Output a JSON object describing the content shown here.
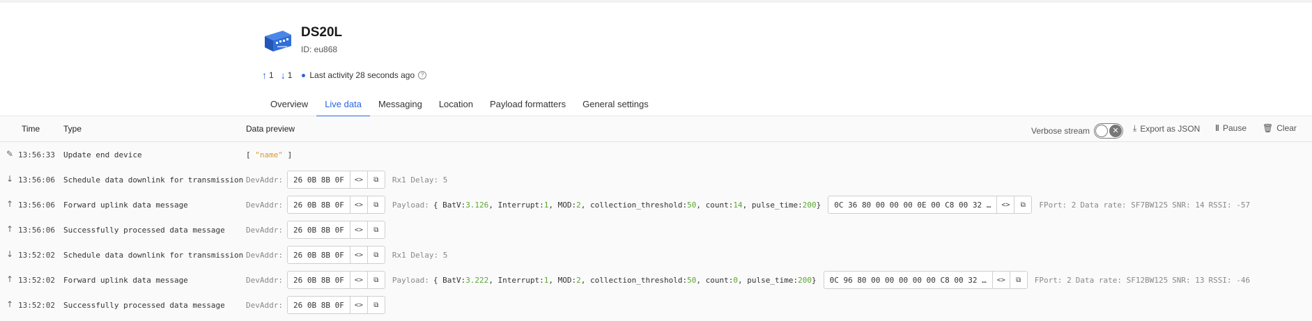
{
  "device": {
    "name": "DS20L",
    "id": "ID: eu868",
    "uplinks": "1",
    "downlinks": "1",
    "last_activity": "Last activity 28 seconds ago"
  },
  "tabs": [
    "Overview",
    "Live data",
    "Messaging",
    "Location",
    "Payload formatters",
    "General settings"
  ],
  "active_tab": "Live data",
  "table": {
    "headers": {
      "time": "Time",
      "type": "Type",
      "preview": "Data preview"
    },
    "controls": {
      "verbose": "Verbose stream",
      "export": "Export as JSON",
      "pause": "Pause",
      "clear": "Clear"
    }
  },
  "rows": [
    {
      "icon": "pencil-icon",
      "time": "13:56:33",
      "type": "Update end device",
      "preview": {
        "open": "[ ",
        "name": "\"name\"",
        "close": " ]"
      }
    },
    {
      "icon": "arrow-down-icon",
      "time": "13:56:06",
      "type": "Schedule data downlink for transmission",
      "devaddr_label": "DevAddr:",
      "devaddr": "26 0B 8B 0F",
      "extra": "Rx1 Delay: 5"
    },
    {
      "icon": "arrow-up-icon",
      "time": "13:56:06",
      "type": "Forward uplink data message",
      "devaddr_label": "DevAddr:",
      "devaddr": "26 0B 8B 0F",
      "payload": {
        "label": "Payload:",
        "BatV": "3.126",
        "Interrupt": "1",
        "MOD": "2",
        "collection_threshold": "50",
        "count": "14",
        "pulse_time": "200"
      },
      "raw": "0C 36 80 00 00 00 0E 00 C8 00 32 …",
      "fport": "FPort: 2",
      "rate": "Data rate: SF7BW125",
      "snr": "SNR: 14",
      "rssi": "RSSI: -57"
    },
    {
      "icon": "arrow-up-icon",
      "time": "13:56:06",
      "type": "Successfully processed data message",
      "devaddr_label": "DevAddr:",
      "devaddr": "26 0B 8B 0F"
    },
    {
      "icon": "arrow-down-icon",
      "time": "13:52:02",
      "type": "Schedule data downlink for transmission",
      "devaddr_label": "DevAddr:",
      "devaddr": "26 0B 8B 0F",
      "extra": "Rx1 Delay: 5"
    },
    {
      "icon": "arrow-up-icon",
      "time": "13:52:02",
      "type": "Forward uplink data message",
      "devaddr_label": "DevAddr:",
      "devaddr": "26 0B 8B 0F",
      "payload": {
        "label": "Payload:",
        "BatV": "3.222",
        "Interrupt": "1",
        "MOD": "2",
        "collection_threshold": "50",
        "count": "0",
        "pulse_time": "200"
      },
      "raw": "0C 96 80 00 00 00 00 00 C8 00 32 …",
      "fport": "FPort: 2",
      "rate": "Data rate: SF12BW125",
      "snr": "SNR: 13",
      "rssi": "RSSI: -46"
    },
    {
      "icon": "arrow-up-icon",
      "time": "13:52:02",
      "type": "Successfully processed data message",
      "devaddr_label": "DevAddr:",
      "devaddr": "26 0B 8B 0F"
    }
  ],
  "colors": {
    "accent": "#2a65e0",
    "number": "#5aa632",
    "string": "#e0962b"
  }
}
